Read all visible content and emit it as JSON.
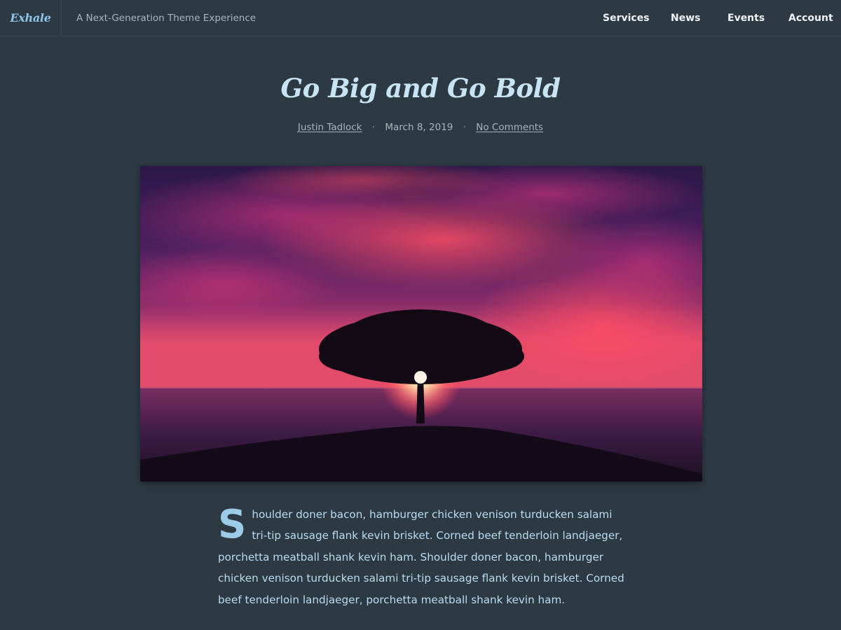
{
  "header": {
    "site_title": "Exhale",
    "tagline": "A Next-Generation Theme Experience",
    "menu": [
      "Services",
      "News",
      "Events",
      "Account"
    ]
  },
  "entry": {
    "title": "Go Big and Go Bold",
    "author": "Justin Tadlock",
    "date": "March 8, 2019",
    "comments": "No Comments",
    "dropcap": "S",
    "content": "houlder doner bacon, hamburger chicken venison turducken salami tri-tip sausage flank kevin brisket. Corned beef tenderloin landjaeger, porchetta meatball shank kevin ham. Shoulder doner bacon, hamburger chicken venison turducken salami tri-tip sausage flank kevin brisket. Corned beef tenderloin landjaeger, porchetta meatball shank kevin ham."
  },
  "colors": {
    "background": "#2d3a44",
    "accent": "#8ec5e8",
    "title": "#c7e4f5",
    "body_text": "#b9dcf2"
  },
  "icons": {
    "meta_separator": "middle-dot"
  }
}
